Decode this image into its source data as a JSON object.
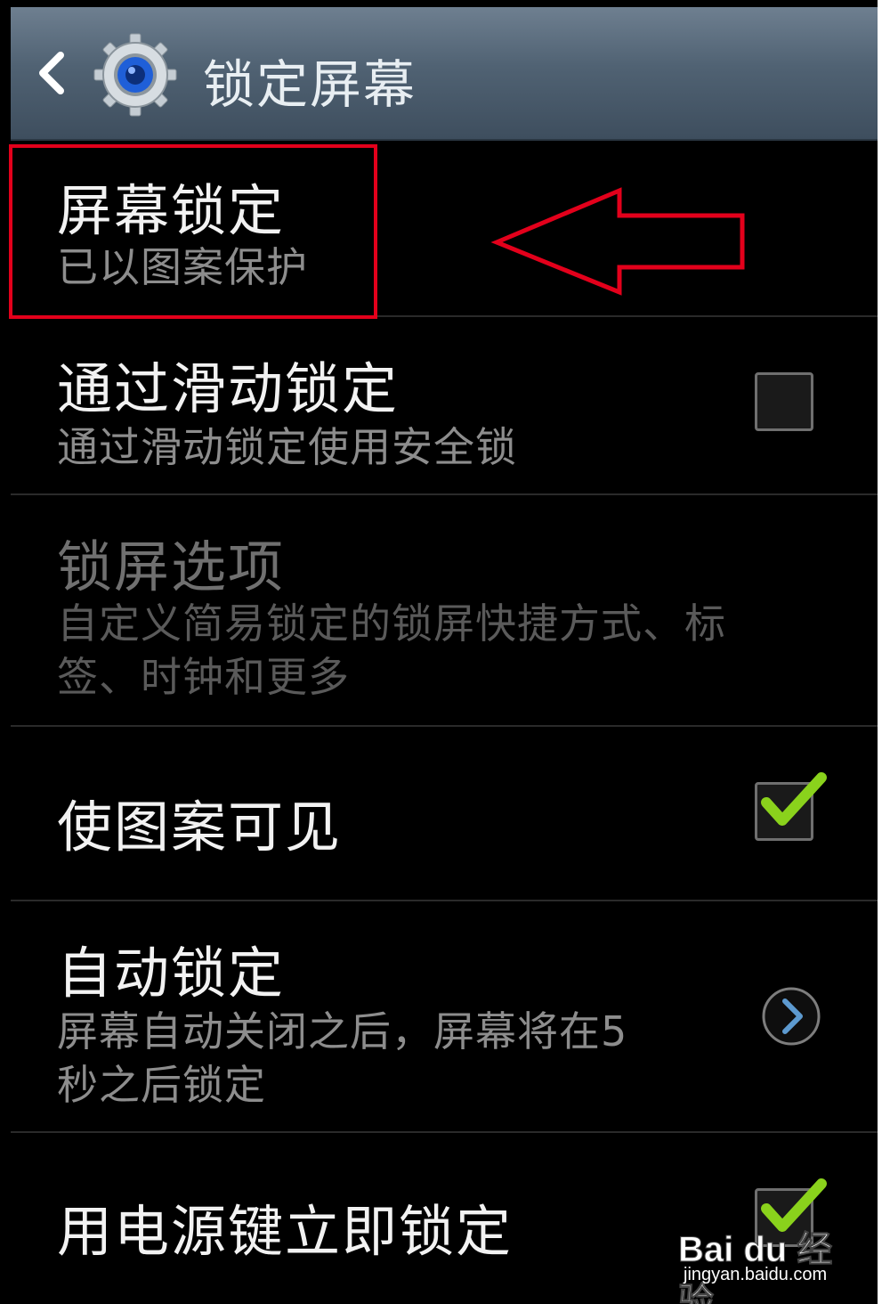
{
  "action_bar": {
    "title": "锁定屏幕",
    "back_icon": "chevron-left-icon",
    "app_icon": "gear-icon"
  },
  "settings": [
    {
      "id": "screen-lock",
      "title": "屏幕锁定",
      "summary": "已以图案保护",
      "control": "none",
      "enabled": true
    },
    {
      "id": "swipe-lock",
      "title": "通过滑动锁定",
      "summary": "通过滑动锁定使用安全锁",
      "control": "checkbox",
      "checked": false,
      "enabled": true
    },
    {
      "id": "lock-screen-options",
      "title": "锁屏选项",
      "summary_line1": "自定义简易锁定的锁屏快捷方式、标",
      "summary_line2": "签、时钟和更多",
      "control": "none",
      "enabled": false
    },
    {
      "id": "make-pattern-visible",
      "title": "使图案可见",
      "control": "checkbox",
      "checked": true,
      "enabled": true
    },
    {
      "id": "auto-lock",
      "title": "自动锁定",
      "summary_line1": "屏幕自动关闭之后，屏幕将在5",
      "summary_line2": "秒之后锁定",
      "control": "chevron-circle",
      "enabled": true
    },
    {
      "id": "power-key-lock",
      "title": "用电源键立即锁定",
      "control": "checkbox",
      "checked": true,
      "enabled": true
    }
  ],
  "annotation": {
    "highlight_color": "#e3001b",
    "highlight_target": "screen-lock"
  },
  "watermark": {
    "logo": "Bai du 经验",
    "url": "jingyan.baidu.com"
  },
  "colors": {
    "background": "#000000",
    "check_green": "#8ad21c",
    "action_bar": "#506273"
  }
}
